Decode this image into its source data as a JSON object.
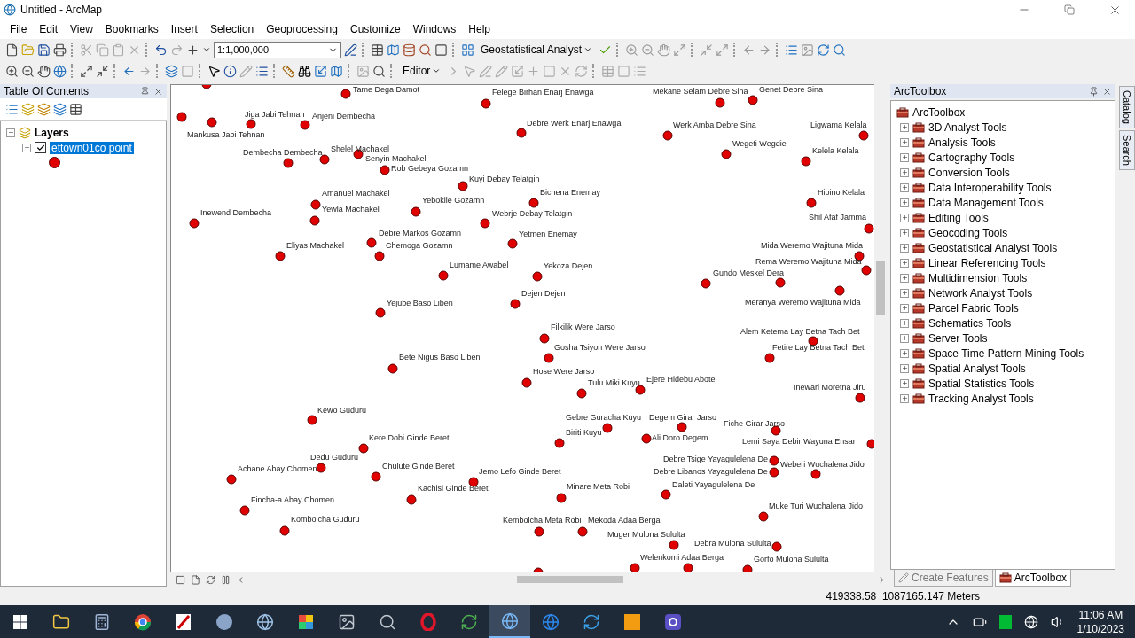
{
  "window": {
    "title": "Untitled - ArcMap"
  },
  "menu": [
    "File",
    "Edit",
    "View",
    "Bookmarks",
    "Insert",
    "Selection",
    "Geoprocessing",
    "Customize",
    "Windows",
    "Help"
  ],
  "toolbar": {
    "scale": "1:1,000,000",
    "geostatistical_menu": "Geostatistical Analyst",
    "editor_menu": "Editor"
  },
  "table_of_contents": {
    "title": "Table Of Contents",
    "layers": {
      "label": "Layers",
      "expanded": true,
      "children": [
        {
          "label": "ettown01co point",
          "checked": true,
          "selected": true,
          "expanded": true
        }
      ]
    }
  },
  "map": {
    "features": [
      {
        "label": "Tame Dega Damot"
      },
      {
        "label": "Felege Birhan Enarj Enawga"
      },
      {
        "label": "Mekane Selam Debre Sina"
      },
      {
        "label": "Genet Debre Sina"
      },
      {
        "label": "Jiga Jabi Tehnan"
      },
      {
        "label": "Anjeni Dembecha"
      },
      {
        "label": "Mankusa Jabi Tehnan"
      },
      {
        "label": "Debre Werk Enarj Enawga"
      },
      {
        "label": "Werk Amba Debre Sina"
      },
      {
        "label": "Ligwama Kelala"
      },
      {
        "label": "Dembecha Dembecha"
      },
      {
        "label": "Shelel Machakel"
      },
      {
        "label": "Wegeti Wegdie"
      },
      {
        "label": "Kelela Kelala"
      },
      {
        "label": "Senyin Machakel"
      },
      {
        "label": "Rob Gebeya Gozamn"
      },
      {
        "label": "Kuyi Debay Telatgin"
      },
      {
        "label": "Amanuel Machakel"
      },
      {
        "label": "Bichena Enemay"
      },
      {
        "label": "Hibino Kelala"
      },
      {
        "label": "Yebokile Gozamn"
      },
      {
        "label": "Inewend Dembecha"
      },
      {
        "label": "Yewla Machakel"
      },
      {
        "label": "Webrje Debay Telatgin"
      },
      {
        "label": "Shil Afaf Jamma"
      },
      {
        "label": "Debre Markos Gozamn"
      },
      {
        "label": "Yetmen Enemay"
      },
      {
        "label": "Eliyas Machakel"
      },
      {
        "label": "Chemoga Gozamn"
      },
      {
        "label": "Mida Weremo Wajituna Mida"
      },
      {
        "label": "Lumame Awabel"
      },
      {
        "label": "Yekoza Dejen"
      },
      {
        "label": "Rema Weremo Wajituna Mida"
      },
      {
        "label": "Gundo Meskel Dera"
      },
      {
        "label": "Dejen Dejen"
      },
      {
        "label": "Yejube Baso Liben"
      },
      {
        "label": "Meranya Weremo Wajituna Mida"
      },
      {
        "label": "Filkilik Were Jarso"
      },
      {
        "label": "Alem Ketema Lay Betna Tach Bet"
      },
      {
        "label": "Gosha Tsiyon Were Jarso"
      },
      {
        "label": "Fetire Lay Betna Tach Bet"
      },
      {
        "label": "Bete Nigus Baso Liben"
      },
      {
        "label": "Hose Were Jarso"
      },
      {
        "label": "Tulu Miki Kuyu"
      },
      {
        "label": "Ejere Hidebu Abote"
      },
      {
        "label": "Inewari Moretna Jiru"
      },
      {
        "label": "Kewo Guduru"
      },
      {
        "label": "Gebre Guracha Kuyu"
      },
      {
        "label": "Degem Girar Jarso"
      },
      {
        "label": "Kere Dobi Ginde Beret"
      },
      {
        "label": "Biriti Kuyu"
      },
      {
        "label": "Ali Doro Degem"
      },
      {
        "label": "Fiche Girar Jarso"
      },
      {
        "label": "Lemi Saya Debir Wayuna Ensar"
      },
      {
        "label": "Dedu Guduru"
      },
      {
        "label": "Achane Abay Chomen"
      },
      {
        "label": "Chulute Ginde Beret"
      },
      {
        "label": "Jemo Lefo Ginde Beret"
      },
      {
        "label": "Debre Tsige Yayagulelena De"
      },
      {
        "label": "Debre Libanos Yayagulelena De"
      },
      {
        "label": "Weberi Wuchalena Jido"
      },
      {
        "label": "Kachisi Ginde Beret"
      },
      {
        "label": "Minare Meta Robi"
      },
      {
        "label": "Daleti Yayagulelena De"
      },
      {
        "label": "Fincha-a Abay Chomen"
      },
      {
        "label": "Muke Turi Wuchalena Jido"
      },
      {
        "label": "Kombolcha Guduru"
      },
      {
        "label": "Kembolcha Meta Robi"
      },
      {
        "label": "Mekoda Adaa Berga"
      },
      {
        "label": "Muger Mulona Sululta"
      },
      {
        "label": "Debra Mulona Sululta"
      },
      {
        "label": "Welenkomi Adaa Berga"
      },
      {
        "label": "Gorfo Mulona Sululta"
      }
    ]
  },
  "arctoolbox": {
    "title": "ArcToolbox",
    "root": "ArcToolbox",
    "tools": [
      {
        "label": "3D Analyst Tools",
        "expanded": false
      },
      {
        "label": "Analysis Tools",
        "expanded": false
      },
      {
        "label": "Cartography Tools",
        "expanded": false
      },
      {
        "label": "Conversion Tools",
        "expanded": false
      },
      {
        "label": "Data Interoperability Tools",
        "expanded": false
      },
      {
        "label": "Data Management Tools",
        "expanded": false
      },
      {
        "label": "Editing Tools",
        "expanded": false
      },
      {
        "label": "Geocoding Tools",
        "expanded": false
      },
      {
        "label": "Geostatistical Analyst Tools",
        "expanded": false
      },
      {
        "label": "Linear Referencing Tools",
        "expanded": false
      },
      {
        "label": "Multidimension Tools",
        "expanded": false
      },
      {
        "label": "Network Analyst Tools",
        "expanded": false
      },
      {
        "label": "Parcel Fabric Tools",
        "expanded": false
      },
      {
        "label": "Schematics Tools",
        "expanded": false
      },
      {
        "label": "Server Tools",
        "expanded": false
      },
      {
        "label": "Space Time Pattern Mining Tools",
        "expanded": false
      },
      {
        "label": "Spatial Analyst Tools",
        "expanded": false
      },
      {
        "label": "Spatial Statistics Tools",
        "expanded": false
      },
      {
        "label": "Tracking Analyst Tools",
        "expanded": false
      }
    ]
  },
  "side_tabs": [
    "Catalog",
    "Search"
  ],
  "dock_tabs": [
    {
      "label": "Create Features",
      "selected": false
    },
    {
      "label": "ArcToolbox",
      "selected": true
    }
  ],
  "status_bar": {
    "coordinates": "419338.58  1087165.147 Meters"
  },
  "taskbar": {
    "time": "11:06 AM",
    "date": "1/10/2023"
  }
}
